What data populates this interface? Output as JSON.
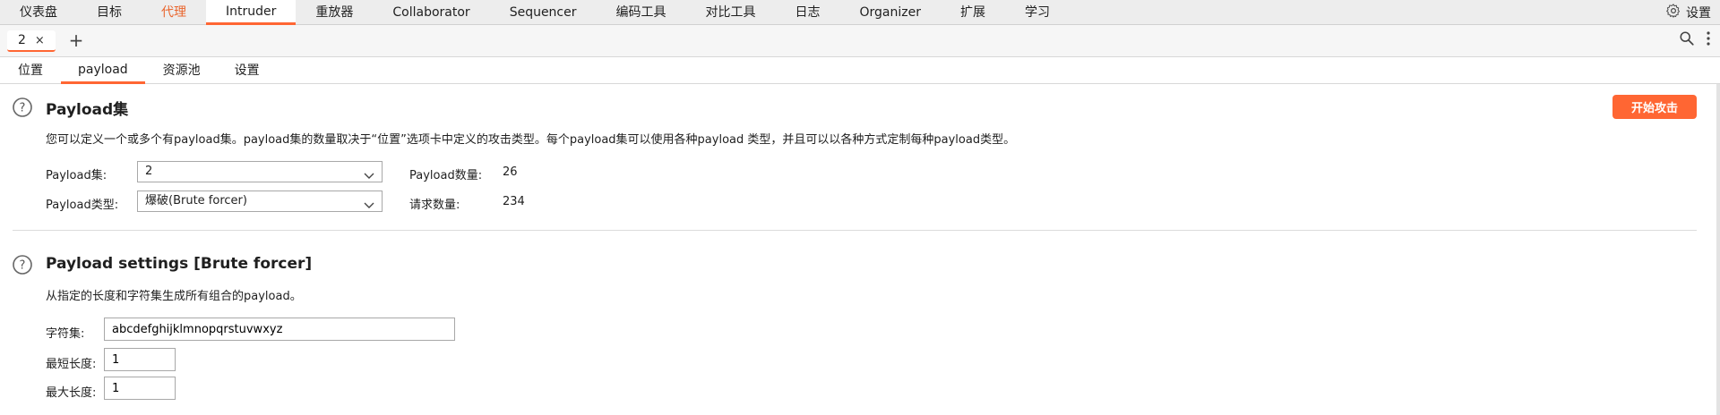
{
  "topnav": {
    "items": [
      {
        "label": "仪表盘"
      },
      {
        "label": "目标"
      },
      {
        "label": "代理"
      },
      {
        "label": "Intruder"
      },
      {
        "label": "重放器"
      },
      {
        "label": "Collaborator"
      },
      {
        "label": "Sequencer"
      },
      {
        "label": "编码工具"
      },
      {
        "label": "对比工具"
      },
      {
        "label": "日志"
      },
      {
        "label": "Organizer"
      },
      {
        "label": "扩展"
      },
      {
        "label": "学习"
      }
    ],
    "accent_item": "代理",
    "active_item": "Intruder",
    "settings_label": "设置",
    "settings_icon": "gear-icon"
  },
  "request_tabs": {
    "tabs": [
      {
        "label": "2",
        "close": "×"
      }
    ],
    "add_label": "+"
  },
  "subtabs": {
    "items": [
      {
        "label": "位置"
      },
      {
        "label": "payload"
      },
      {
        "label": "资源池"
      },
      {
        "label": "设置"
      }
    ],
    "active_item": "payload"
  },
  "payload_sets": {
    "title": "Payload集",
    "description": "您可以定义一个或多个有payload集。payload集的数量取决于“位置”选项卡中定义的攻击类型。每个payload集可以使用各种payload 类型，并且可以以各种方式定制每种payload类型。",
    "set_label": "Payload集:",
    "set_value": "2",
    "type_label": "Payload类型:",
    "type_value": "爆破(Brute forcer)",
    "count_label": "Payload数量:",
    "count_value": "26",
    "request_label": "请求数量:",
    "request_value": "234",
    "attack_button": "开始攻击"
  },
  "payload_settings": {
    "title": "Payload settings [Brute forcer]",
    "description": "从指定的长度和字符集生成所有组合的payload。",
    "charset_label": "字符集:",
    "charset_value": "abcdefghijklmnopqrstuvwxyz",
    "min_label": "最短长度:",
    "min_value": "1",
    "max_label": "最大长度:",
    "max_value": "1"
  },
  "colors": {
    "accent": "#ff6633",
    "accent_text": "#e9652d"
  }
}
